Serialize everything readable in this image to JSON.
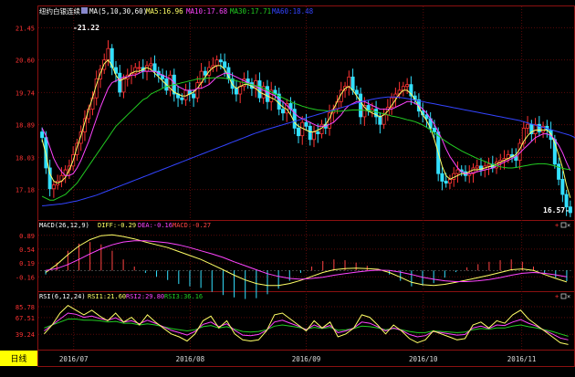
{
  "chart_data": [
    {
      "type": "candlestick",
      "panel": "price",
      "title": "纽约白银连续",
      "indicator_label": "MA(5,10,30,60)",
      "legend": [
        {
          "label": "MA5:16.96",
          "color": "#ffff66"
        },
        {
          "label": "MA10:17.68",
          "color": "#ff44ff"
        },
        {
          "label": "MA30:17.71",
          "color": "#22cc22"
        },
        {
          "label": "MA60:18.48",
          "color": "#3344ff"
        }
      ],
      "y_ticks": [
        "21.45",
        "20.60",
        "19.74",
        "18.89",
        "18.03",
        "17.18"
      ],
      "ylim": [
        16.4,
        21.7
      ],
      "annotations": [
        {
          "text": "-21.22",
          "value": 21.22
        },
        {
          "text": "16.57-",
          "value": 16.57
        }
      ],
      "close": [
        18.55,
        17.75,
        17.2,
        17.3,
        17.4,
        17.55,
        17.7,
        17.8,
        18.1,
        18.4,
        18.7,
        19.05,
        19.3,
        19.6,
        20.1,
        20.35,
        20.6,
        20.9,
        20.4,
        20.25,
        19.75,
        20.1,
        20.2,
        20.25,
        20.4,
        20.4,
        20.3,
        20.45,
        20.5,
        20.3,
        20.2,
        20.1,
        19.8,
        20.2,
        19.7,
        19.6,
        19.55,
        19.8,
        19.7,
        19.6,
        20.0,
        20.3,
        20.2,
        20.4,
        20.45,
        20.6,
        20.55,
        20.4,
        20.1,
        19.85,
        19.7,
        19.9,
        20.1,
        20.0,
        19.85,
        20.05,
        19.6,
        19.9,
        19.5,
        19.8,
        19.7,
        19.3,
        19.2,
        19.45,
        19.3,
        18.8,
        18.6,
        18.95,
        18.85,
        18.5,
        18.7,
        18.65,
        18.9,
        18.8,
        19.2,
        19.3,
        19.5,
        19.8,
        19.9,
        20.15,
        19.8,
        19.7,
        19.1,
        19.4,
        19.25,
        19.3,
        19.1,
        18.9,
        19.15,
        19.35,
        19.6,
        19.7,
        19.8,
        19.9,
        19.95,
        19.65,
        19.55,
        19.25,
        19.15,
        19.05,
        18.8,
        18.7,
        17.6,
        17.4,
        17.35,
        17.45,
        17.6,
        17.7,
        17.65,
        17.55,
        17.6,
        17.75,
        17.8,
        17.7,
        17.8,
        17.85,
        17.75,
        17.9,
        17.95,
        18.0,
        18.1,
        18.05,
        17.95,
        18.4,
        18.8,
        18.9,
        18.65,
        18.9,
        18.7,
        18.85,
        18.75,
        18.5,
        17.85,
        17.45,
        17.05,
        16.72,
        16.57
      ],
      "ma": {
        "MA5": [
          18.5,
          18.1,
          17.6,
          17.4,
          17.35,
          17.4,
          17.5,
          17.7,
          17.95,
          18.3,
          18.6,
          18.95,
          19.3,
          19.6,
          19.95,
          20.25,
          20.5,
          20.6,
          20.45,
          20.2,
          20.05,
          20.1,
          20.15,
          20.25,
          20.3,
          20.3,
          20.35,
          20.4,
          20.35,
          20.25,
          20.15,
          20.05,
          19.95,
          19.85,
          19.75,
          19.7,
          19.65,
          19.65,
          19.7,
          19.75,
          19.85,
          20.0,
          20.15,
          20.3,
          20.4,
          20.45,
          20.45,
          20.35,
          20.15,
          19.95,
          19.85,
          19.9,
          19.95,
          19.95,
          19.9,
          19.85,
          19.75,
          19.7,
          19.65,
          19.6,
          19.55,
          19.45,
          19.35,
          19.3,
          19.15,
          18.95,
          18.85,
          18.8,
          18.75,
          18.7,
          18.7,
          18.75,
          18.8,
          18.9,
          19.05,
          19.3,
          19.5,
          19.7,
          19.85,
          19.9,
          19.8,
          19.65,
          19.5,
          19.35,
          19.25,
          19.2,
          19.15,
          19.1,
          19.15,
          19.25,
          19.4,
          19.55,
          19.7,
          19.8,
          19.8,
          19.7,
          19.55,
          19.35,
          19.15,
          19.0,
          18.8,
          18.5,
          18.15,
          17.8,
          17.55,
          17.45,
          17.5,
          17.55,
          17.6,
          17.6,
          17.65,
          17.7,
          17.7,
          17.72,
          17.75,
          17.78,
          17.8,
          17.85,
          17.9,
          17.95,
          18.0,
          18.05,
          18.1,
          18.25,
          18.45,
          18.6,
          18.7,
          18.75,
          18.75,
          18.75,
          18.75,
          18.65,
          18.4,
          18.1,
          17.75,
          17.3,
          16.96
        ],
        "MA10": [
          18.8,
          18.6,
          18.3,
          18.0,
          17.8,
          17.65,
          17.55,
          17.55,
          17.6,
          17.75,
          17.95,
          18.2,
          18.45,
          18.75,
          19.05,
          19.35,
          19.6,
          19.85,
          20.0,
          20.05,
          20.1,
          20.15,
          20.15,
          20.2,
          20.2,
          20.25,
          20.3,
          20.3,
          20.3,
          20.3,
          20.25,
          20.2,
          20.15,
          20.1,
          20.0,
          19.9,
          19.85,
          19.8,
          19.8,
          19.8,
          19.85,
          19.85,
          19.9,
          19.95,
          20.05,
          20.15,
          20.2,
          20.25,
          20.25,
          20.2,
          20.15,
          20.1,
          20.05,
          20.0,
          19.95,
          19.9,
          19.85,
          19.8,
          19.75,
          19.7,
          19.65,
          19.55,
          19.5,
          19.4,
          19.3,
          19.2,
          19.1,
          19.05,
          19.0,
          18.95,
          18.9,
          18.85,
          18.85,
          18.85,
          18.9,
          18.95,
          19.05,
          19.15,
          19.3,
          19.4,
          19.45,
          19.5,
          19.5,
          19.5,
          19.45,
          19.4,
          19.35,
          19.3,
          19.3,
          19.3,
          19.3,
          19.35,
          19.4,
          19.45,
          19.5,
          19.5,
          19.45,
          19.4,
          19.3,
          19.2,
          19.05,
          18.9,
          18.7,
          18.5,
          18.25,
          18.05,
          17.9,
          17.75,
          17.65,
          17.6,
          17.6,
          17.62,
          17.65,
          17.67,
          17.7,
          17.72,
          17.75,
          17.8,
          17.85,
          17.9,
          17.95,
          18.0,
          18.05,
          18.15,
          18.25,
          18.35,
          18.45,
          18.55,
          18.6,
          18.65,
          18.65,
          18.6,
          18.5,
          18.35,
          18.15,
          17.9,
          17.68
        ],
        "MA30": [
          17.0,
          16.95,
          16.9,
          16.9,
          16.95,
          17.0,
          17.05,
          17.15,
          17.25,
          17.35,
          17.5,
          17.65,
          17.8,
          17.95,
          18.1,
          18.25,
          18.4,
          18.55,
          18.7,
          18.85,
          18.95,
          19.05,
          19.15,
          19.25,
          19.35,
          19.45,
          19.55,
          19.6,
          19.7,
          19.75,
          19.8,
          19.85,
          19.9,
          19.92,
          19.95,
          19.97,
          20.0,
          20.02,
          20.05,
          20.07,
          20.1,
          20.1,
          20.12,
          20.12,
          20.13,
          20.13,
          20.13,
          20.12,
          20.1,
          20.08,
          20.05,
          20.02,
          20.0,
          19.97,
          19.95,
          19.92,
          19.9,
          19.85,
          19.8,
          19.75,
          19.7,
          19.65,
          19.6,
          19.55,
          19.5,
          19.45,
          19.42,
          19.38,
          19.35,
          19.32,
          19.3,
          19.28,
          19.27,
          19.26,
          19.25,
          19.25,
          19.25,
          19.25,
          19.26,
          19.27,
          19.28,
          19.28,
          19.28,
          19.27,
          19.26,
          19.25,
          19.23,
          19.2,
          19.18,
          19.15,
          19.12,
          19.1,
          19.08,
          19.05,
          19.02,
          19.0,
          18.97,
          18.93,
          18.88,
          18.82,
          18.75,
          18.67,
          18.6,
          18.52,
          18.45,
          18.38,
          18.32,
          18.26,
          18.2,
          18.15,
          18.1,
          18.05,
          18.0,
          17.96,
          17.92,
          17.88,
          17.84,
          17.81,
          17.78,
          17.76,
          17.75,
          17.75,
          17.76,
          17.78,
          17.8,
          17.82,
          17.84,
          17.85,
          17.86,
          17.86,
          17.85,
          17.83,
          17.8,
          17.77,
          17.74,
          17.72,
          17.71
        ],
        "MA60": [
          16.75,
          16.76,
          16.77,
          16.78,
          16.79,
          16.8,
          16.82,
          16.84,
          16.86,
          16.88,
          16.91,
          16.94,
          16.97,
          17.0,
          17.03,
          17.07,
          17.11,
          17.15,
          17.19,
          17.23,
          17.27,
          17.31,
          17.35,
          17.39,
          17.43,
          17.47,
          17.51,
          17.55,
          17.59,
          17.63,
          17.67,
          17.71,
          17.75,
          17.79,
          17.83,
          17.87,
          17.91,
          17.95,
          17.99,
          18.03,
          18.07,
          18.11,
          18.15,
          18.19,
          18.23,
          18.27,
          18.31,
          18.35,
          18.39,
          18.43,
          18.47,
          18.51,
          18.55,
          18.59,
          18.63,
          18.67,
          18.7,
          18.74,
          18.77,
          18.8,
          18.83,
          18.86,
          18.89,
          18.92,
          18.95,
          18.98,
          19.01,
          19.04,
          19.07,
          19.1,
          19.13,
          19.16,
          19.19,
          19.22,
          19.25,
          19.28,
          19.31,
          19.34,
          19.37,
          19.4,
          19.43,
          19.46,
          19.49,
          19.52,
          19.54,
          19.56,
          19.58,
          19.6,
          19.61,
          19.62,
          19.62,
          19.62,
          19.61,
          19.6,
          19.58,
          19.56,
          19.54,
          19.52,
          19.5,
          19.48,
          19.46,
          19.44,
          19.42,
          19.4,
          19.38,
          19.36,
          19.34,
          19.32,
          19.3,
          19.28,
          19.26,
          19.24,
          19.22,
          19.2,
          19.18,
          19.16,
          19.14,
          19.12,
          19.1,
          19.08,
          19.06,
          19.04,
          19.02,
          19.0,
          18.97,
          18.94,
          18.91,
          18.88,
          18.85,
          18.82,
          18.79,
          18.76,
          18.73,
          18.7,
          18.67,
          18.64,
          18.61,
          18.56,
          18.48
        ]
      }
    },
    {
      "type": "line+bar",
      "panel": "macd",
      "indicator_label": "MACD(26,12,9)",
      "legend": [
        {
          "label": "DIFF:-0.29",
          "color": "#ffff66"
        },
        {
          "label": "DEA:-0.16",
          "color": "#ff44ff"
        },
        {
          "label": "MACD:-0.27",
          "color": "#ff4444"
        }
      ],
      "y_ticks": [
        "0.89",
        "0.54",
        "0.19",
        "-0.16"
      ],
      "ylim": [
        -0.5,
        1.0
      ],
      "series": [
        {
          "name": "DIFF",
          "values": [
            -0.05,
            0.15,
            0.4,
            0.62,
            0.78,
            0.88,
            0.9,
            0.86,
            0.8,
            0.72,
            0.65,
            0.58,
            0.48,
            0.38,
            0.28,
            0.15,
            0.02,
            -0.12,
            -0.24,
            -0.33,
            -0.38,
            -0.38,
            -0.33,
            -0.25,
            -0.15,
            -0.05,
            0.02,
            0.05,
            0.06,
            0.05,
            0.03,
            -0.05,
            -0.17,
            -0.3,
            -0.36,
            -0.38,
            -0.35,
            -0.3,
            -0.24,
            -0.18,
            -0.12,
            -0.05,
            0.02,
            0.04,
            0.0,
            -0.1,
            -0.2,
            -0.29
          ]
        },
        {
          "name": "DEA",
          "values": [
            0.0,
            0.05,
            0.15,
            0.28,
            0.42,
            0.55,
            0.65,
            0.72,
            0.75,
            0.75,
            0.73,
            0.7,
            0.65,
            0.58,
            0.5,
            0.42,
            0.33,
            0.22,
            0.12,
            0.02,
            -0.08,
            -0.15,
            -0.2,
            -0.22,
            -0.2,
            -0.17,
            -0.12,
            -0.08,
            -0.04,
            -0.01,
            0.01,
            0.0,
            -0.04,
            -0.1,
            -0.17,
            -0.22,
            -0.26,
            -0.28,
            -0.28,
            -0.26,
            -0.23,
            -0.18,
            -0.12,
            -0.07,
            -0.05,
            -0.07,
            -0.11,
            -0.16
          ]
        },
        {
          "name": "MACD",
          "values": [
            -0.1,
            0.2,
            0.5,
            0.68,
            0.72,
            0.66,
            0.5,
            0.28,
            0.1,
            -0.06,
            -0.16,
            -0.24,
            -0.34,
            -0.4,
            -0.44,
            -0.54,
            -0.62,
            -0.68,
            -0.72,
            -0.7,
            -0.6,
            -0.46,
            -0.26,
            -0.06,
            0.1,
            0.24,
            0.28,
            0.26,
            0.2,
            0.12,
            0.04,
            -0.1,
            -0.26,
            -0.4,
            -0.38,
            -0.32,
            -0.18,
            -0.04,
            0.08,
            0.16,
            0.22,
            0.26,
            0.28,
            0.22,
            0.1,
            -0.06,
            -0.18,
            -0.27
          ]
        }
      ]
    },
    {
      "type": "line",
      "panel": "rsi",
      "indicator_label": "RSI(6,12,24)",
      "legend": [
        {
          "label": "RSI1:21.60",
          "color": "#ffff66"
        },
        {
          "label": "RSI2:29.80",
          "color": "#ff44ff"
        },
        {
          "label": "RSI3:36.16",
          "color": "#22cc22"
        }
      ],
      "y_ticks": [
        "85.78",
        "67.51",
        "39.24"
      ],
      "ylim": [
        15,
        95
      ],
      "series": [
        {
          "name": "RSI1",
          "values": [
            40,
            55,
            75,
            88,
            80,
            72,
            80,
            70,
            62,
            75,
            60,
            68,
            55,
            72,
            60,
            50,
            40,
            35,
            28,
            40,
            62,
            70,
            50,
            62,
            40,
            30,
            28,
            30,
            45,
            72,
            75,
            65,
            55,
            45,
            62,
            50,
            60,
            35,
            40,
            50,
            72,
            68,
            55,
            40,
            55,
            45,
            32,
            25,
            30,
            45,
            40,
            35,
            30,
            32,
            55,
            60,
            50,
            62,
            58,
            72,
            80,
            65,
            55,
            45,
            35,
            25,
            22
          ]
        },
        {
          "name": "RSI2",
          "values": [
            45,
            55,
            65,
            75,
            73,
            68,
            70,
            66,
            63,
            67,
            60,
            62,
            57,
            63,
            58,
            52,
            46,
            42,
            38,
            44,
            56,
            60,
            52,
            57,
            46,
            38,
            37,
            39,
            46,
            60,
            63,
            58,
            53,
            47,
            55,
            50,
            54,
            42,
            45,
            50,
            60,
            58,
            52,
            45,
            50,
            46,
            39,
            35,
            37,
            44,
            42,
            40,
            38,
            39,
            50,
            53,
            49,
            55,
            54,
            60,
            64,
            58,
            53,
            46,
            40,
            33,
            30
          ]
        },
        {
          "name": "RSI3",
          "values": [
            50,
            55,
            60,
            65,
            65,
            63,
            63,
            62,
            60,
            61,
            58,
            58,
            55,
            57,
            55,
            52,
            49,
            47,
            45,
            47,
            52,
            54,
            50,
            52,
            48,
            44,
            43,
            44,
            47,
            53,
            55,
            53,
            51,
            48,
            51,
            49,
            51,
            46,
            47,
            49,
            53,
            52,
            50,
            47,
            49,
            47,
            44,
            42,
            42,
            45,
            44,
            43,
            42,
            43,
            47,
            49,
            48,
            50,
            50,
            53,
            55,
            52,
            50,
            47,
            44,
            40,
            36
          ]
        }
      ]
    },
    {
      "type": "axis",
      "x_ticks": [
        "2016/07",
        "2016/08",
        "2016/09",
        "2016/10",
        "2016/11"
      ],
      "period_button": "日线"
    }
  ]
}
